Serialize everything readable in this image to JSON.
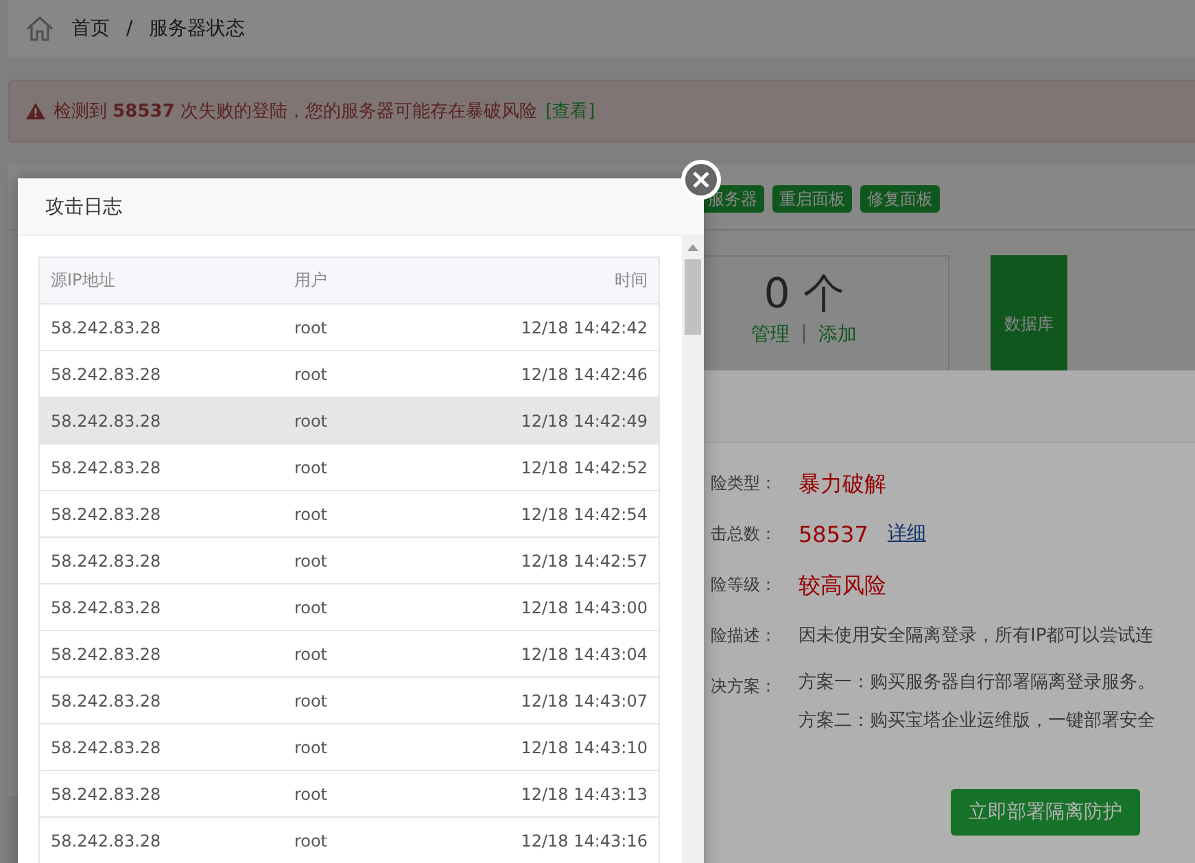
{
  "breadcrumb": {
    "items": [
      "首页",
      "服务器状态"
    ],
    "separator": "/"
  },
  "alert": {
    "text": "检测到 **58537** 次失败的登陆，您的服务器可能存在暴破风险",
    "link": "[查看]"
  },
  "toolbar": {
    "buttons": [
      "服务器",
      "重启面板",
      "修复面板"
    ]
  },
  "stat": {
    "value": "0 个",
    "links": [
      "管理",
      "添加"
    ],
    "separator": "|"
  },
  "tile": {
    "label": "数据库"
  },
  "risk_dialog": {
    "rows": [
      {
        "kind": "red",
        "label": "险类型：",
        "value": "暴力破解"
      },
      {
        "kind": "count",
        "label": "击总数：",
        "value": "58537",
        "link": "详细"
      },
      {
        "kind": "red",
        "label": "险等级：",
        "value": "较高风险"
      },
      {
        "kind": "text",
        "label": "险描述：",
        "value": "因未使用安全隔离登录，所有IP都可以尝试连"
      },
      {
        "kind": "list",
        "label": "决方案：",
        "lines": [
          "方案一：购买服务器自行部署隔离登录服务。",
          "方案二：购买宝塔企业运维版，一键部署安全"
        ]
      }
    ],
    "button": "立即部署隔离防护"
  },
  "log_dialog": {
    "title": "攻击日志",
    "columns": [
      "源IP地址",
      "用户",
      "时间"
    ],
    "rows": [
      {
        "ip": "58.242.83.28",
        "user": "root",
        "time": "12/18 14:42:42",
        "selected": false
      },
      {
        "ip": "58.242.83.28",
        "user": "root",
        "time": "12/18 14:42:46",
        "selected": false
      },
      {
        "ip": "58.242.83.28",
        "user": "root",
        "time": "12/18 14:42:49",
        "selected": true
      },
      {
        "ip": "58.242.83.28",
        "user": "root",
        "time": "12/18 14:42:52",
        "selected": false
      },
      {
        "ip": "58.242.83.28",
        "user": "root",
        "time": "12/18 14:42:54",
        "selected": false
      },
      {
        "ip": "58.242.83.28",
        "user": "root",
        "time": "12/18 14:42:57",
        "selected": false
      },
      {
        "ip": "58.242.83.28",
        "user": "root",
        "time": "12/18 14:43:00",
        "selected": false
      },
      {
        "ip": "58.242.83.28",
        "user": "root",
        "time": "12/18 14:43:04",
        "selected": false
      },
      {
        "ip": "58.242.83.28",
        "user": "root",
        "time": "12/18 14:43:07",
        "selected": false
      },
      {
        "ip": "58.242.83.28",
        "user": "root",
        "time": "12/18 14:43:10",
        "selected": false
      },
      {
        "ip": "58.242.83.28",
        "user": "root",
        "time": "12/18 14:43:13",
        "selected": false
      },
      {
        "ip": "58.242.83.28",
        "user": "root",
        "time": "12/18 14:43:16",
        "selected": false
      }
    ]
  }
}
